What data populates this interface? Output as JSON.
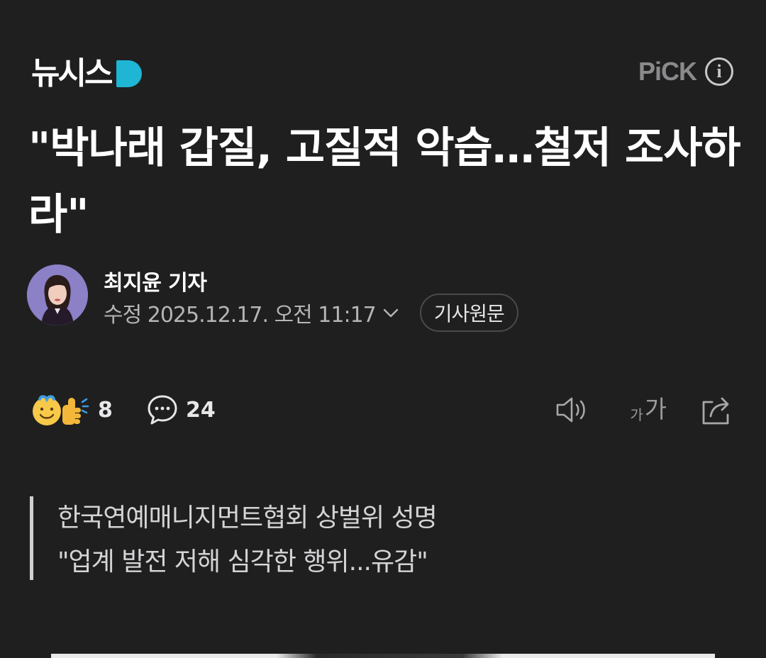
{
  "header": {
    "logo_text": "뉴시스",
    "pick_label": "PiCK",
    "info_icon": "info-icon"
  },
  "article": {
    "headline": "\"박나래 갑질, 고질적 악습…철저 조사하라\"",
    "author": {
      "name": "최지윤 기자",
      "updated": "수정 2025.12.17. 오전 11:17",
      "original_label": "기사원문"
    },
    "reactions": {
      "count": "8"
    },
    "comments": {
      "count": "24"
    },
    "summary": [
      "한국연예매니지먼트협회 상벌위 성명",
      "\"업계 발전 저해 심각한 행위...유감\""
    ]
  },
  "toolbar": {
    "fontsize_small": "가",
    "fontsize_big": "가"
  },
  "colors": {
    "background": "#1f1f20",
    "logo_accent": "#1fb5d4",
    "muted_text": "#b5b5b7"
  }
}
